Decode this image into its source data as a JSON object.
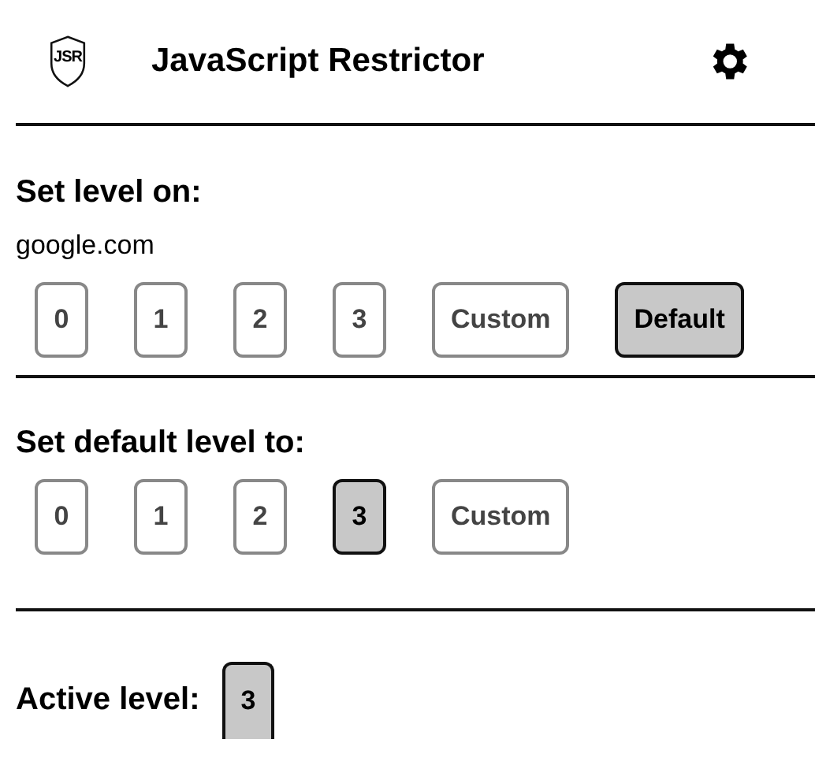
{
  "header": {
    "logo_text": "JSR",
    "title": "JavaScript Restrictor"
  },
  "site_section": {
    "heading": "Set level on:",
    "site": "google.com",
    "buttons": [
      {
        "label": "0",
        "selected": false
      },
      {
        "label": "1",
        "selected": false
      },
      {
        "label": "2",
        "selected": false
      },
      {
        "label": "3",
        "selected": false
      },
      {
        "label": "Custom",
        "selected": false
      },
      {
        "label": "Default",
        "selected": true
      }
    ]
  },
  "default_section": {
    "heading": "Set default level to:",
    "buttons": [
      {
        "label": "0",
        "selected": false
      },
      {
        "label": "1",
        "selected": false
      },
      {
        "label": "2",
        "selected": false
      },
      {
        "label": "3",
        "selected": true
      },
      {
        "label": "Custom",
        "selected": false
      }
    ]
  },
  "active": {
    "label": "Active level:",
    "value": "3"
  }
}
